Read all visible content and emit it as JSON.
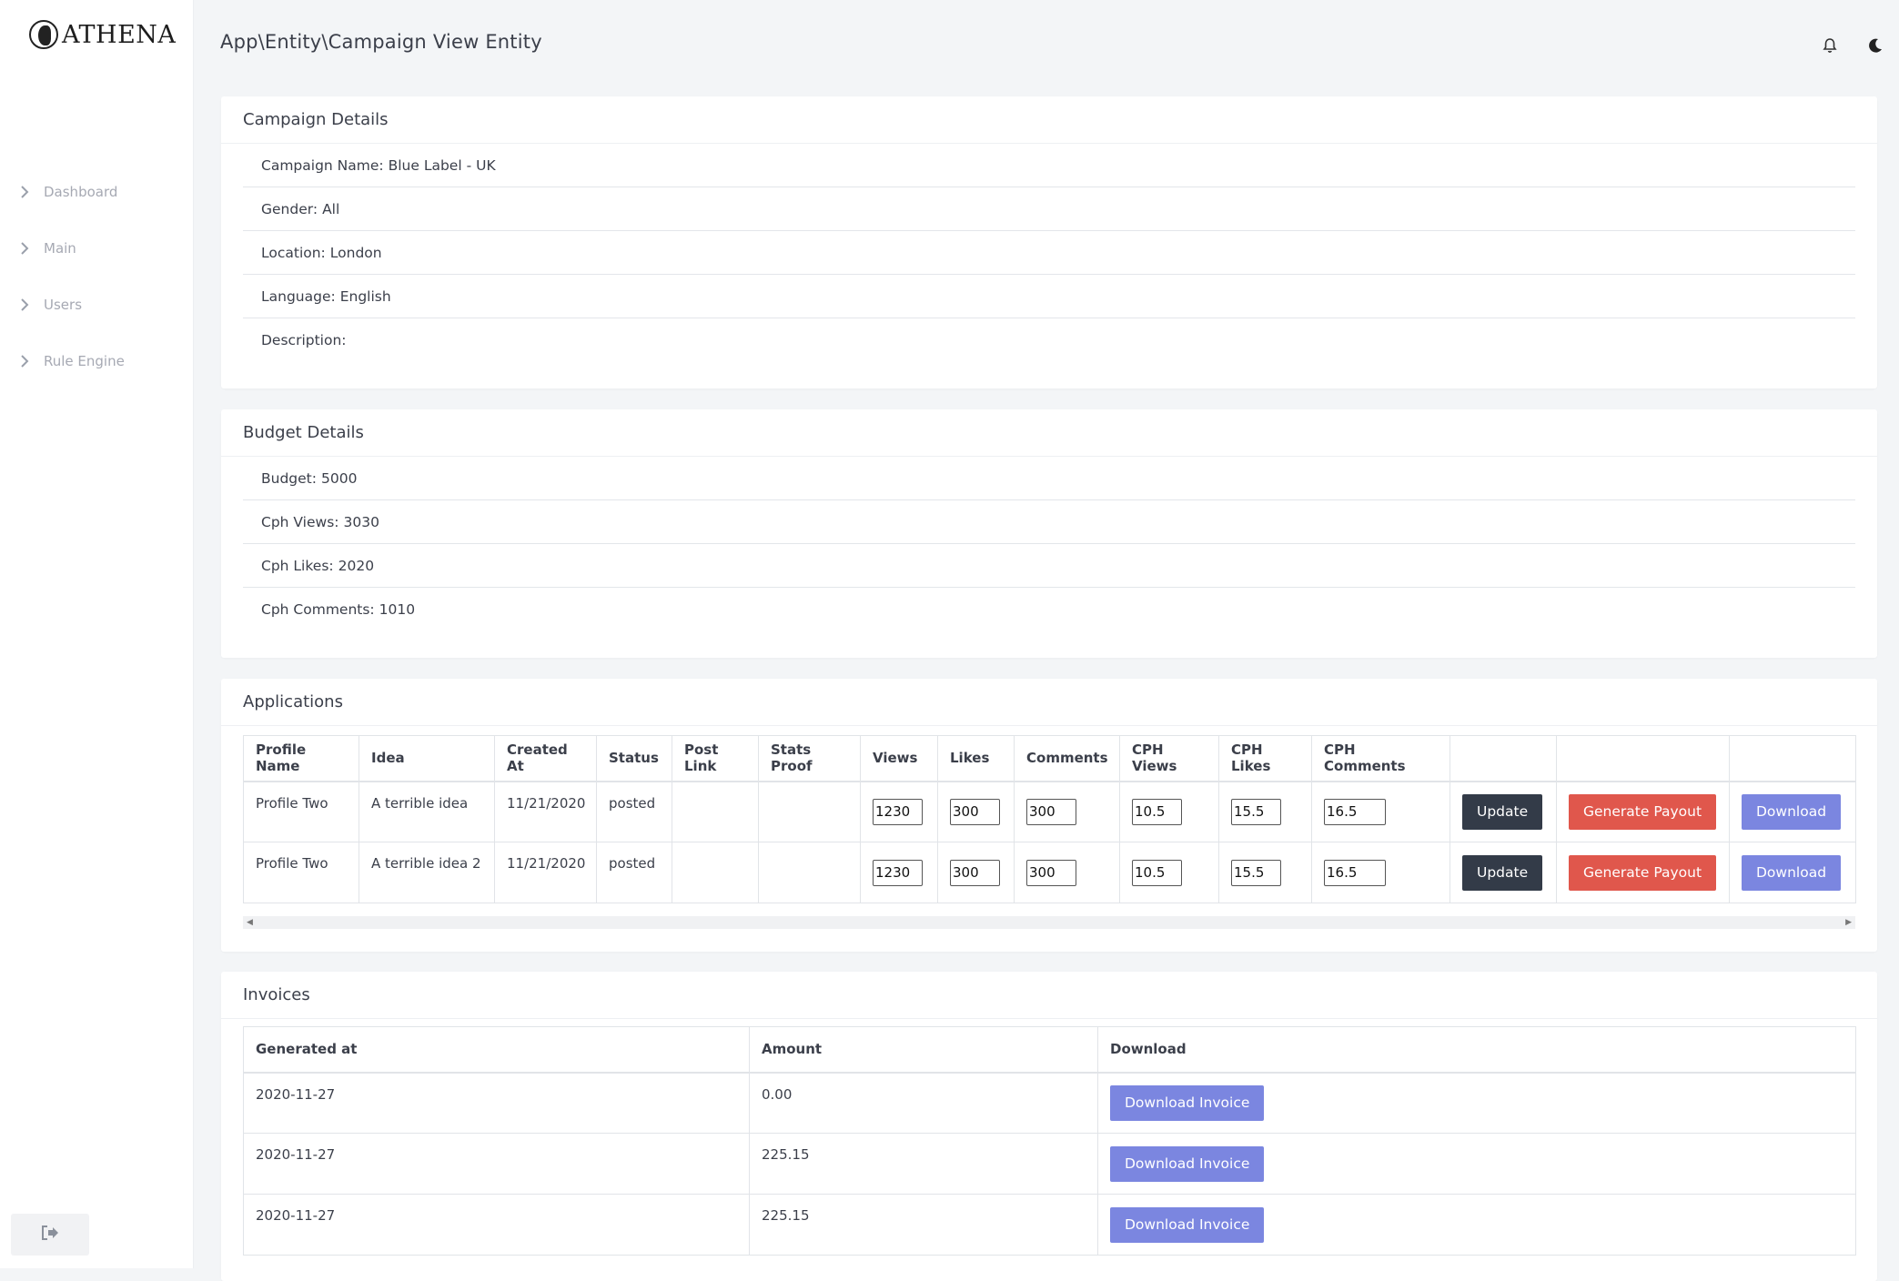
{
  "brand": {
    "logo_text": "ATHENA"
  },
  "sidebar": {
    "items": [
      {
        "label": "Dashboard"
      },
      {
        "label": "Main"
      },
      {
        "label": "Users"
      },
      {
        "label": "Rule Engine"
      }
    ]
  },
  "header": {
    "breadcrumb": "App\\Entity\\Campaign View Entity"
  },
  "campaign_details": {
    "title": "Campaign Details",
    "rows": [
      {
        "label": "Campaign Name:",
        "value": "Blue Label - UK"
      },
      {
        "label": "Gender:",
        "value": "All"
      },
      {
        "label": "Location:",
        "value": "London"
      },
      {
        "label": "Language:",
        "value": "English"
      },
      {
        "label": "Description:",
        "value": ""
      }
    ]
  },
  "budget_details": {
    "title": "Budget Details",
    "rows": [
      {
        "label": "Budget:",
        "value": "5000"
      },
      {
        "label": "Cph Views:",
        "value": "3030"
      },
      {
        "label": "Cph Likes:",
        "value": "2020"
      },
      {
        "label": "Cph Comments:",
        "value": "1010"
      }
    ]
  },
  "applications": {
    "title": "Applications",
    "columns": [
      "Profile Name",
      "Idea",
      "Created At",
      "Status",
      "Post Link",
      "Stats Proof",
      "Views",
      "Likes",
      "Comments",
      "CPH Views",
      "CPH Likes",
      "CPH Comments",
      "",
      "",
      ""
    ],
    "rows": [
      {
        "profile": "Profile Two",
        "idea": "A terrible idea",
        "created": "11/21/2020",
        "status": "posted",
        "post_link": "",
        "stats_proof": "",
        "views": "1230",
        "likes": "300",
        "comments": "300",
        "cph_views": "10.5",
        "cph_likes": "15.5",
        "cph_comments": "16.5"
      },
      {
        "profile": "Profile Two",
        "idea": "A terrible idea 2",
        "created": "11/21/2020",
        "status": "posted",
        "post_link": "",
        "stats_proof": "",
        "views": "1230",
        "likes": "300",
        "comments": "300",
        "cph_views": "10.5",
        "cph_likes": "15.5",
        "cph_comments": "16.5"
      }
    ],
    "update_label": "Update",
    "payout_label": "Generate Payout",
    "download_label": "Download"
  },
  "invoices": {
    "title": "Invoices",
    "columns": [
      "Generated at",
      "Amount",
      "Download"
    ],
    "rows": [
      {
        "generated": "2020-11-27",
        "amount": "0.00"
      },
      {
        "generated": "2020-11-27",
        "amount": "225.15"
      },
      {
        "generated": "2020-11-27",
        "amount": "225.15"
      }
    ],
    "download_label": "Download Invoice"
  },
  "colors": {
    "accent_blue": "#7b86e0",
    "danger_red": "#e0574c",
    "dark_button": "#333b48"
  },
  "icons": {
    "nav_chevron": "chevron-right-icon",
    "bell": "bell-icon",
    "theme": "moon-icon",
    "logout": "logout-icon"
  }
}
